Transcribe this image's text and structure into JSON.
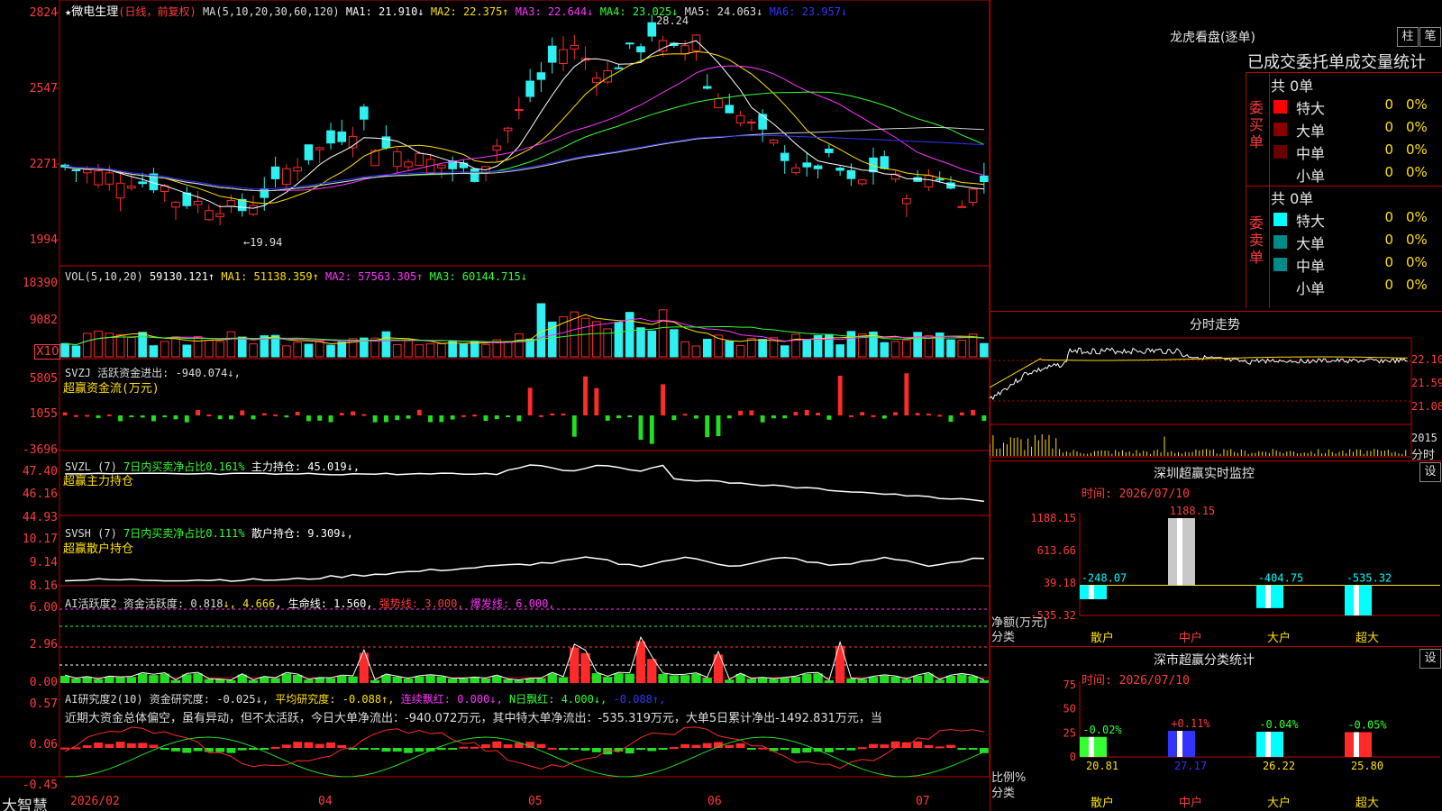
{
  "colors": {
    "bg": "#000000",
    "up": "#ff2a2a",
    "down": "#2ef0f0",
    "grid": "#c00000",
    "ma1": "#ffffff",
    "ma2": "#ffe000",
    "ma3": "#ff33ff",
    "ma4": "#33ff33",
    "ma5": "#d0d0d0",
    "ma6": "#3333ff",
    "green_bar": "#22dd22"
  },
  "header": {
    "star": "★",
    "name": "微电生理",
    "mode": "(日线，前复权)",
    "ma_label": "MA(5,10,20,30,60,120)",
    "ma1": "MA1: 21.910↓",
    "ma2": "MA2: 22.375↑",
    "ma3": "MA3: 22.644↓",
    "ma4": "MA4: 23.025↓",
    "ma5": "MA5: 24.063↓",
    "ma6": "MA6: 23.957↓"
  },
  "price_axis": [
    "2824",
    "2547",
    "2271",
    "1994"
  ],
  "price_annot": {
    "high": "28.24",
    "low": "←19.94"
  },
  "vol": {
    "label": "VOL(5,10,20)",
    "value": "59130.121↑",
    "ma1": "MA1: 51138.359↑",
    "ma2": "MA2: 57563.305↑",
    "ma3": "MA3: 60144.715↓",
    "axis": [
      "18390",
      "9082"
    ],
    "unit": "X10"
  },
  "svzj": {
    "label": "SVZJ  活跃资金进出: -940.074↓,",
    "sub": "超赢资金流(万元)",
    "axis": [
      "5805",
      "1055",
      "-3696"
    ]
  },
  "svzl": {
    "label": "SVZL (7)",
    "pct": "7日内买卖净占比0.161%",
    "hold": "主力持仓: 45.019↓,",
    "sub": "超赢主力持仓",
    "axis": [
      "47.40",
      "46.16",
      "44.93"
    ]
  },
  "svsh": {
    "label": "SVSH (7)",
    "pct": "7日内买卖净占比0.111%",
    "hold": "散户持仓: 9.309↓,",
    "sub": "超赢散户持仓",
    "axis": [
      "10.17",
      "9.14",
      "8.16"
    ]
  },
  "ai1": {
    "label": "AI活跃度2 资金活跃度: 0.818",
    "v2": "↓, 4.666",
    "life": ", 生命线: 1.560,",
    "strong": "强势线: 3.000,",
    "burst": "爆发线: 6.000,",
    "axis": [
      "6.00",
      "2.96",
      "0.00"
    ]
  },
  "ai2": {
    "label": "AI研究度2(10) 资金研究度: -0.025↓,",
    "avg": "平均研究度: -0.088↑,",
    "red": "连续飘红: 0.000↓,",
    "nred": "N日飘红: 4.000↓,",
    "last": "-0.088↑,",
    "desc": "近期大资金总体偏空，虽有异动，但不太活跃，今日大单净流出：-940.072万元，其中特大单净流出：-535.319万元，大单5日累计净出-1492.831万元，当",
    "axis": [
      "0.57",
      "0.06",
      "-0.45"
    ]
  },
  "date_axis": {
    "brand": "大智慧",
    "labels": [
      "2026/02",
      "04",
      "05",
      "06",
      "07"
    ]
  },
  "lhb": {
    "title": "龙虎看盘(逐单)",
    "btn1": "柱",
    "btn2": "笔",
    "subtitle": "已成交委托单成交量统计",
    "buy_label": "委买单",
    "sell_label": "委卖单",
    "buy_total": "共 0单",
    "sell_total": "共 0单",
    "buy_rows": [
      {
        "name": "特大",
        "v": "0",
        "p": "0%",
        "color": "#ff0000"
      },
      {
        "name": "大单",
        "v": "0",
        "p": "0%",
        "color": "#8a0000"
      },
      {
        "name": "中单",
        "v": "0",
        "p": "0%",
        "color": "#6a0000"
      },
      {
        "name": "小单",
        "v": "0",
        "p": "0%",
        "color": "#000000"
      }
    ],
    "sell_rows": [
      {
        "name": "特大",
        "v": "0",
        "p": "0%",
        "color": "#00ffff"
      },
      {
        "name": "大单",
        "v": "0",
        "p": "0%",
        "color": "#008a8a"
      },
      {
        "name": "中单",
        "v": "0",
        "p": "0%",
        "color": "#008a8a"
      },
      {
        "name": "小单",
        "v": "0",
        "p": "0%",
        "color": "#000000"
      }
    ]
  },
  "fenshi": {
    "title": "分时走势",
    "axis": [
      "22.10",
      "21.59",
      "21.08"
    ],
    "vol": "2015",
    "label": "分时"
  },
  "monitor": {
    "title": "深圳超赢实时监控",
    "btn": "设",
    "time": "时间: 2026/07/10",
    "axis": [
      "1188.15",
      "613.66",
      "39.18",
      "-535.32"
    ],
    "ylabel": "净额(万元)",
    "xlabel": "分类",
    "bars": [
      {
        "name": "散户",
        "value": -248.07,
        "label": "-248.07"
      },
      {
        "name": "中户",
        "value": 1188.15,
        "label": "1188.15"
      },
      {
        "name": "大户",
        "value": -404.75,
        "label": "-404.75"
      },
      {
        "name": "超大",
        "value": -535.32,
        "label": "-535.32"
      }
    ]
  },
  "classify": {
    "title": "深市超赢分类统计",
    "btn": "设",
    "time": "时间: 2026/07/10",
    "axis": [
      "75",
      "50",
      "25",
      "0"
    ],
    "ylabel": "比例%",
    "xlabel": "分类",
    "bars": [
      {
        "name": "散户",
        "value": 20.81,
        "label": "20.81",
        "delta": "-0.02%",
        "color": "#33ff33"
      },
      {
        "name": "中户",
        "value": 27.17,
        "label": "27.17",
        "delta": "+0.11%",
        "color": "#3333ff"
      },
      {
        "name": "大户",
        "value": 26.22,
        "label": "26.22",
        "delta": "-0.04%",
        "color": "#00ffff"
      },
      {
        "name": "超大",
        "value": 25.8,
        "label": "25.80",
        "delta": "-0.05%",
        "color": "#ff2a2a"
      }
    ]
  }
}
